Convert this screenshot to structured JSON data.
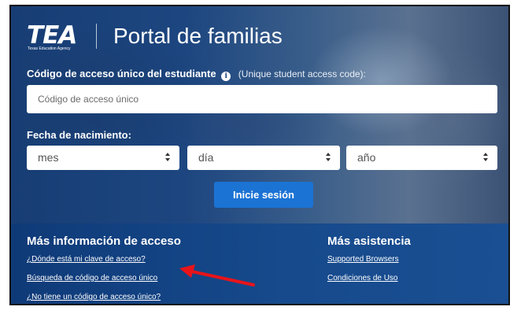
{
  "header": {
    "logo_text": "TEA",
    "logo_subtitle": "Texas Education Agency",
    "title": "Portal de familias"
  },
  "form": {
    "code_label": "Código de acceso único del estudiante",
    "code_hint": "(Unique student access code):",
    "code_placeholder": "Código de acceso único",
    "code_value": "",
    "dob_label": "Fecha de nacimiento:",
    "month_select": "mes",
    "day_select": "día",
    "year_select": "año",
    "login_button": "Inicie sesión"
  },
  "footer": {
    "left_heading": "Más información de acceso",
    "left_links": [
      "¿Dónde está mi clave de acceso?",
      "Búsqueda de código de acceso único",
      "¿No tiene un código de acceso único?"
    ],
    "right_heading": "Más asistencia",
    "right_links": [
      "Supported Browsers",
      "Condiciones de Uso"
    ]
  },
  "annotation": {
    "arrow_color": "#e8141a"
  },
  "icons": {
    "info": "info-icon",
    "select_arrows": "select-arrows-icon",
    "pointer_arrow": "red-arrow-icon"
  }
}
